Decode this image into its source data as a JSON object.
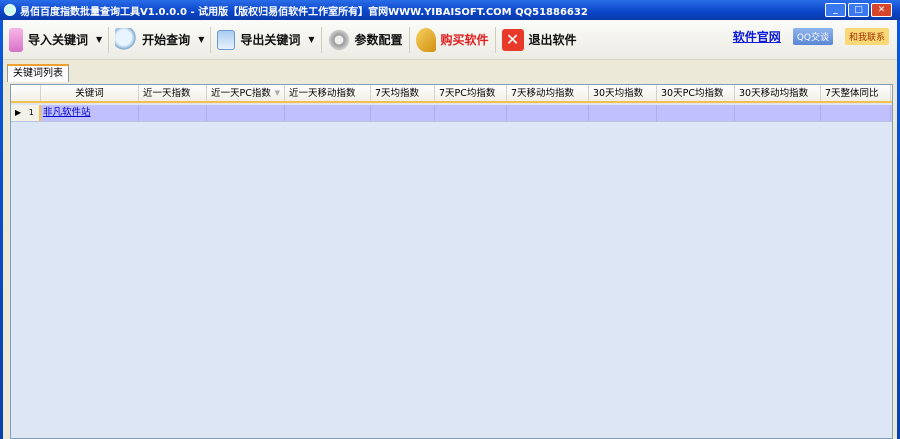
{
  "window": {
    "title": "易佰百度指数批量查询工具V1.0.0.0 - 试用版【版权归易佰软件工作室所有】官网WWW.YIBAISOFT.COM QQ51886632"
  },
  "toolbar": {
    "import": "导入关键词",
    "start": "开始查询",
    "export": "导出关键词",
    "settings": "参数配置",
    "buy": "购买软件",
    "exit": "退出软件",
    "website": "软件官网",
    "qq": "QQ交谈",
    "contact": "和我联系"
  },
  "tab": "关键词列表",
  "columns": [
    "关键词",
    "近一天指数",
    "近一天PC指数",
    "近一天移动指数",
    "7天均指数",
    "7天PC均指数",
    "7天移动均指数",
    "30天均指数",
    "30天PC均指数",
    "30天移动均指数",
    "7天整体同比"
  ],
  "rows": [
    {
      "num": "1",
      "keyword": "非凡软件站"
    }
  ],
  "colors": {
    "selected_row": "#c0c0ff",
    "grid_bg": "#dce6f4",
    "accent": "#f5c04a"
  }
}
